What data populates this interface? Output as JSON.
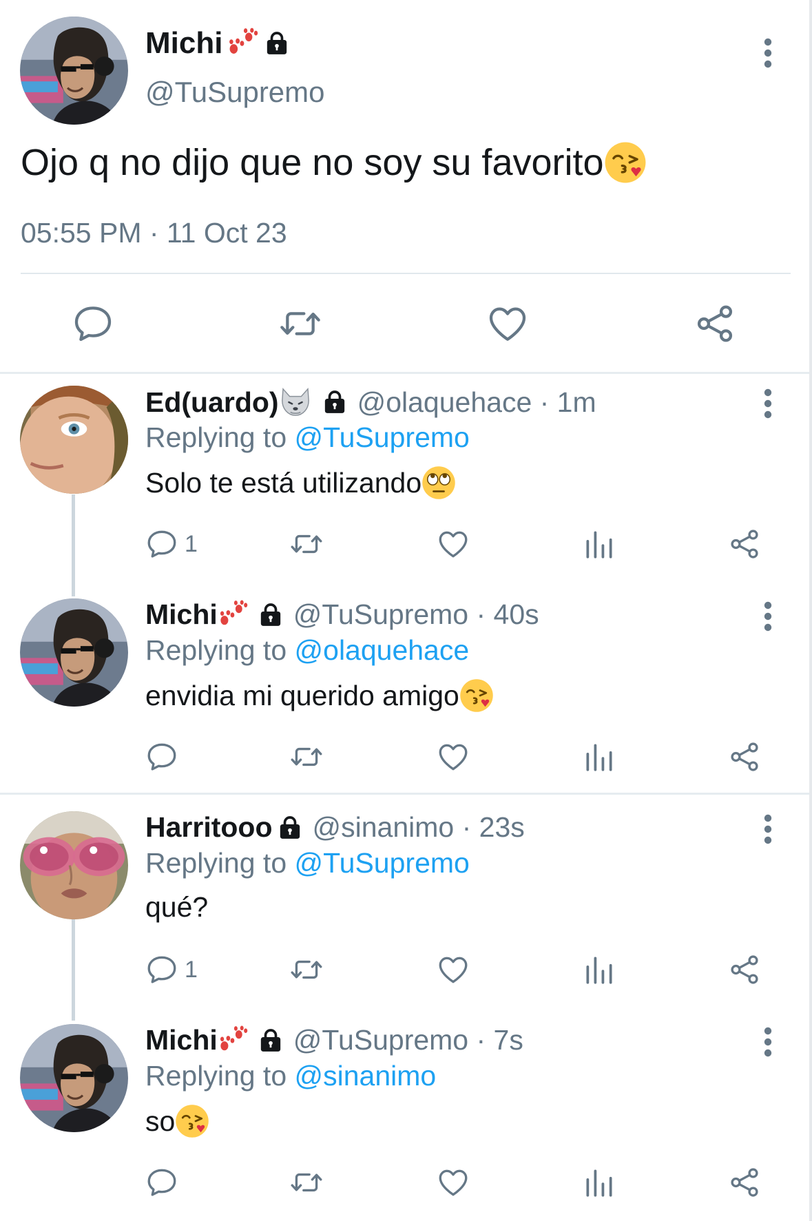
{
  "main_tweet": {
    "author_name": "Michi",
    "author_handle": "@TuSupremo",
    "text": "Ojo q no dijo que no soy su favorito",
    "timestamp": "05:55 PM · 11 Oct 23",
    "icons": [
      "paw-emoji",
      "lock-icon",
      "kiss-emoji",
      "more-icon",
      "reply-icon",
      "retweet-icon",
      "like-icon",
      "share-icon"
    ]
  },
  "replies": [
    {
      "name": "Ed(uardo)",
      "meta": "@olaquehace · 1m",
      "replying_prefix": "Replying to ",
      "replying_to": "@TuSupremo",
      "text": "Solo te está utilizando",
      "reply_count": "1",
      "name_emoji": "wolf-emoji",
      "text_emoji": "eye-roll-emoji"
    },
    {
      "name": "Michi",
      "meta": "@TuSupremo · 40s",
      "replying_prefix": "Replying to ",
      "replying_to": "@olaquehace",
      "text": "envidia mi querido amigo",
      "reply_count": "",
      "name_emoji": "paw-emoji",
      "text_emoji": "kiss-emoji"
    },
    {
      "name": "Harritooo",
      "meta": "@sinanimo · 23s",
      "replying_prefix": "Replying to ",
      "replying_to": "@TuSupremo",
      "text": "qué?",
      "reply_count": "1",
      "name_emoji": "",
      "text_emoji": ""
    },
    {
      "name": "Michi",
      "meta": "@TuSupremo · 7s",
      "replying_prefix": "Replying to ",
      "replying_to": "@sinanimo",
      "text": "so",
      "reply_count": "",
      "name_emoji": "paw-emoji",
      "text_emoji": "kiss-emoji"
    }
  ],
  "colors": {
    "text": "#14171a",
    "secondary": "#657786",
    "mention": "#1da1f2",
    "icon": "#657786",
    "divider": "#e1e8ed"
  }
}
